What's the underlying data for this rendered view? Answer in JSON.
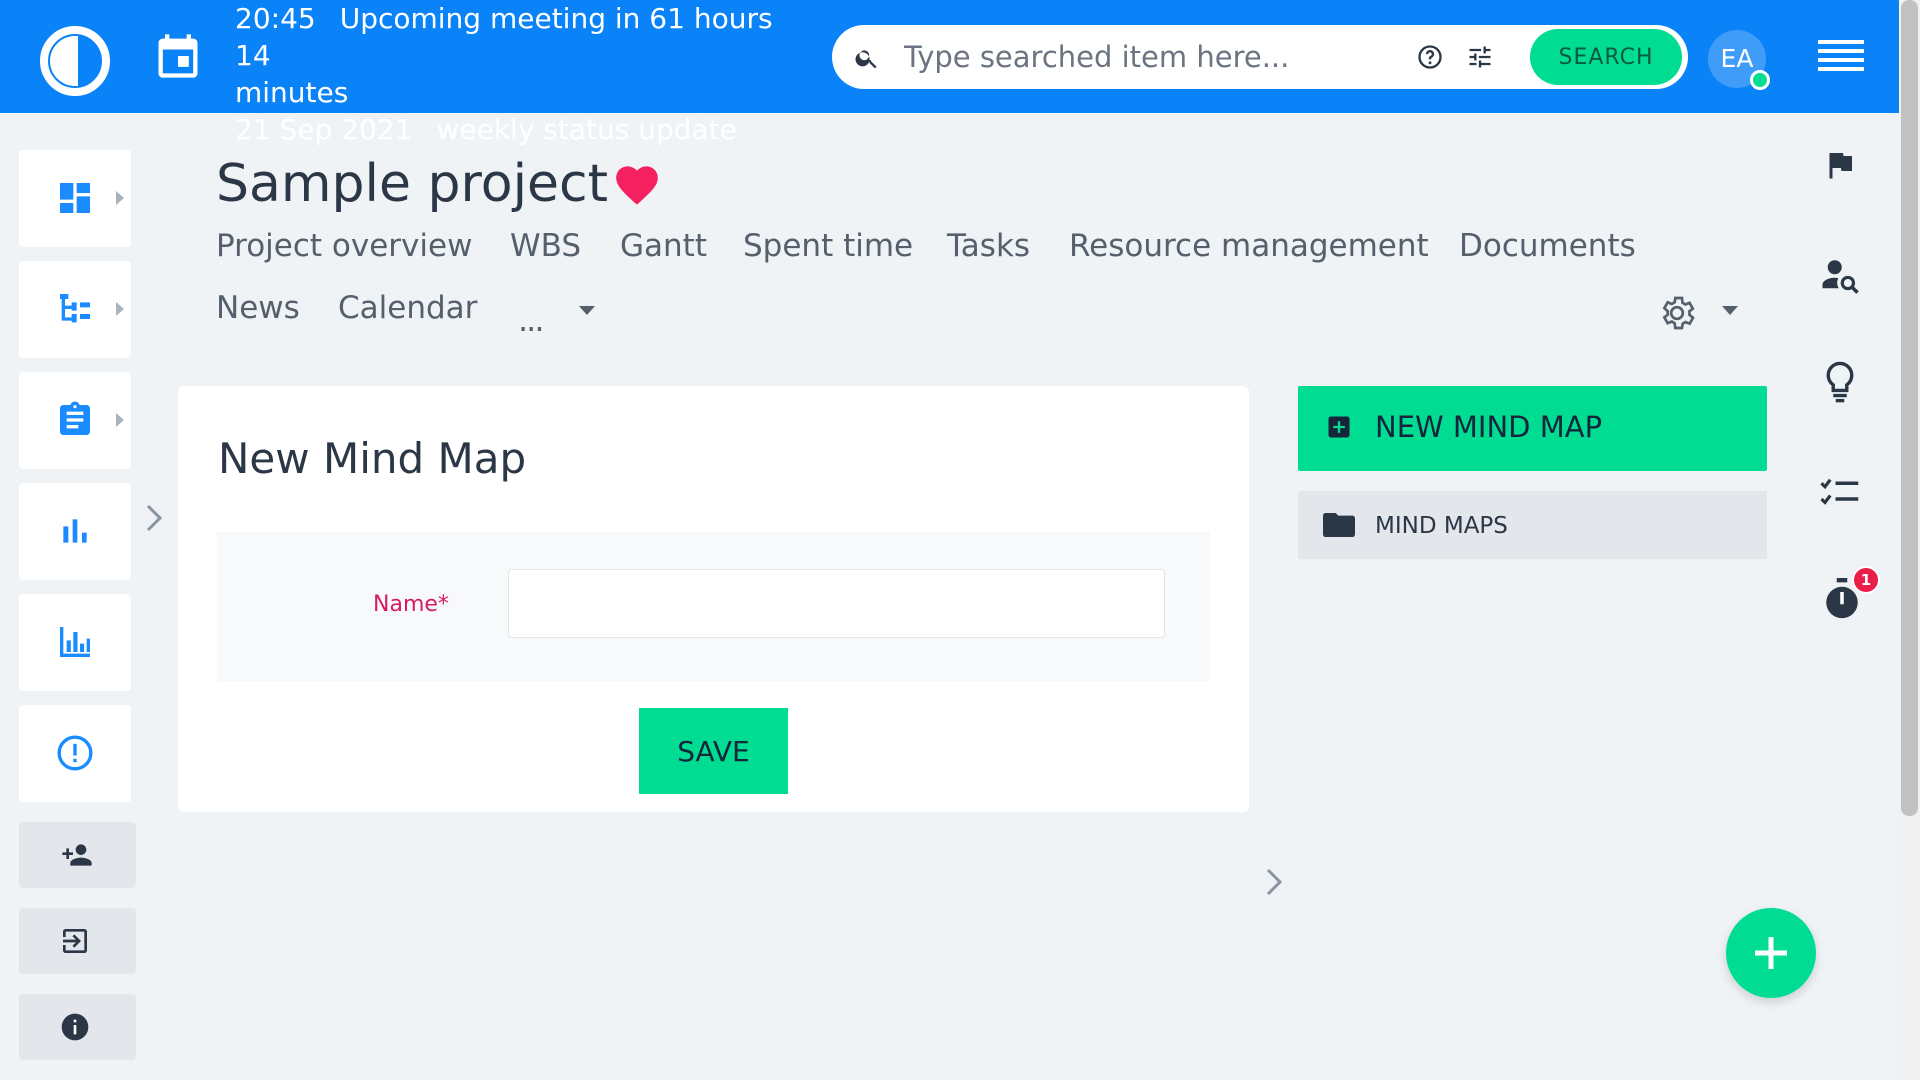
{
  "topbar": {
    "meeting_line1": "20:45",
    "meeting_line1_text": "Upcoming meeting in 61 hours 14",
    "meeting_line2": "minutes",
    "meeting_line3_date": "21 Sep 2021",
    "meeting_line3_text": "weekly status update",
    "search_placeholder": "Type searched item here...",
    "search_button": "SEARCH",
    "avatar_initials": "EA",
    "colors": {
      "bar": "#0b83f8",
      "accent": "#00dc91"
    }
  },
  "project": {
    "title": "Sample project",
    "favorite_icon": "heart-icon",
    "tabs": [
      "Project overview",
      "WBS",
      "Gantt",
      "Spent time",
      "Tasks",
      "Resource management",
      "Documents",
      "News",
      "Calendar"
    ],
    "more_label": "..."
  },
  "form": {
    "heading": "New Mind Map",
    "name_label": "Name*",
    "name_value": "",
    "save_label": "SAVE"
  },
  "side_panel": {
    "new_button": "NEW MIND MAP",
    "list_item": "MIND MAPS"
  },
  "sidebar_icons": [
    "dashboard-icon",
    "hierarchy-icon",
    "clipboard-icon",
    "bar-chart-icon",
    "column-chart-icon",
    "alert-icon",
    "add-user-icon",
    "login-icon",
    "info-icon"
  ],
  "right_rail_icons": [
    "flag-icon",
    "user-search-icon",
    "lightbulb-icon",
    "checklist-icon",
    "timer-icon"
  ],
  "timer_badge": "1"
}
